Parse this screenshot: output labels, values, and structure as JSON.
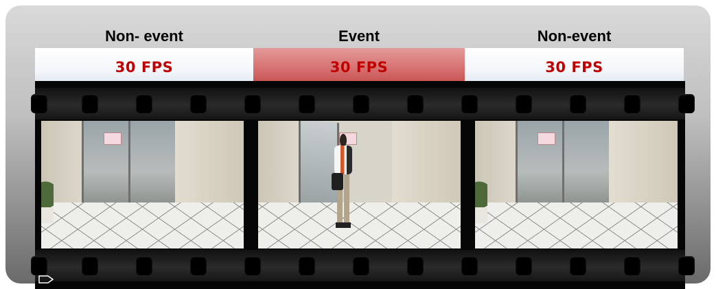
{
  "columns": [
    {
      "header": "Non- event",
      "fps": "30 FPS",
      "state": "non-event"
    },
    {
      "header": "Event",
      "fps": "30 FPS",
      "state": "event"
    },
    {
      "header": "Non-event",
      "fps": "30 FPS",
      "state": "non-event"
    }
  ],
  "colors": {
    "fps_text": "#c00000",
    "event_highlight": "#d66f6f",
    "non_event_highlight": "#f3f6fa",
    "film": "#050505"
  },
  "icons": {
    "footer": "play-outline-icon"
  }
}
